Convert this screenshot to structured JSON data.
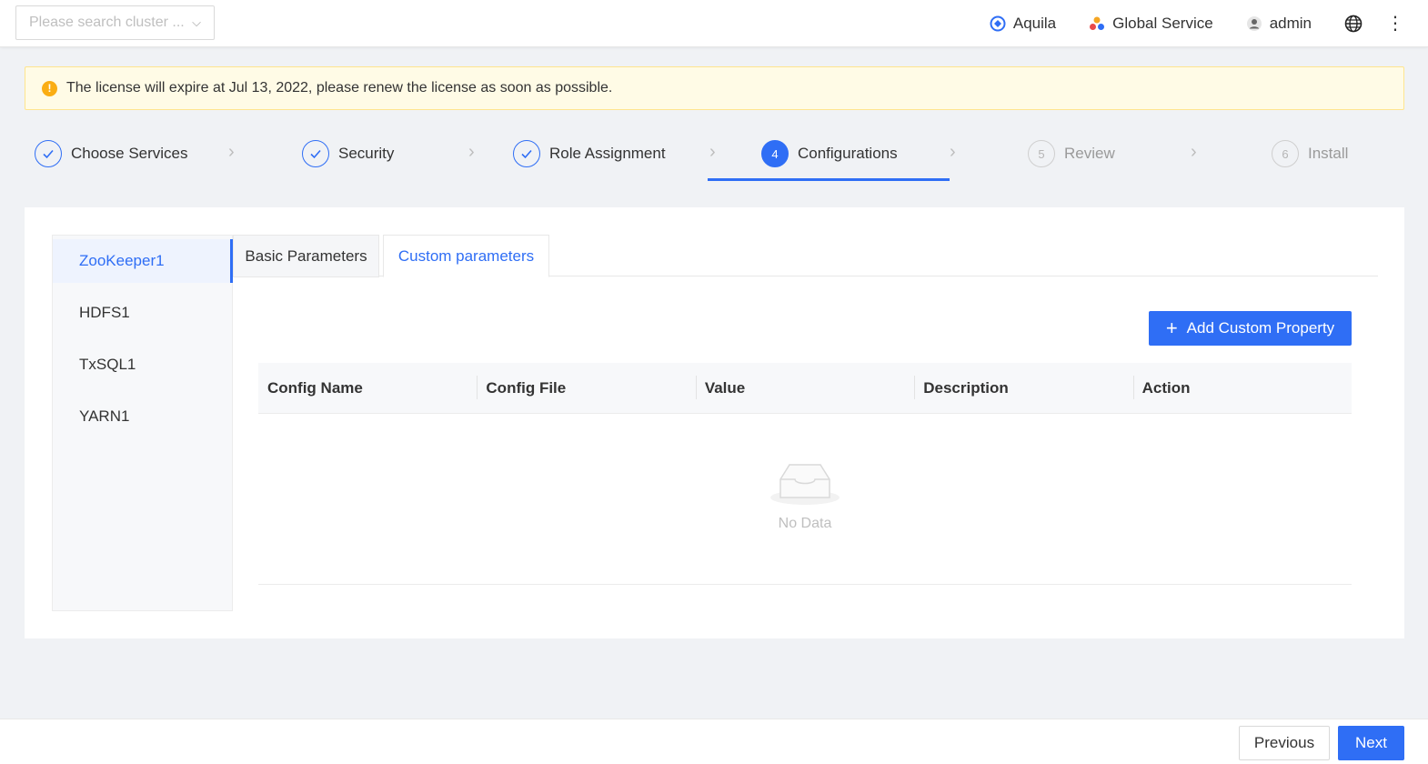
{
  "header": {
    "cluster_search": {
      "placeholder": "Please search cluster ..."
    },
    "product": "Aquila",
    "service": "Global Service",
    "user": "admin",
    "icons": [
      "aquila-logo-icon",
      "global-service-icon",
      "user-icon",
      "globe-icon",
      "more-vertical-icon"
    ]
  },
  "banner": {
    "message": "The license will expire at Jul 13, 2022, please renew the license as soon as possible.",
    "icon": "warning-icon",
    "color": "#faad14"
  },
  "steps": [
    {
      "label": "Choose Services",
      "status": "done"
    },
    {
      "label": "Security",
      "status": "done"
    },
    {
      "label": "Role Assignment",
      "status": "done"
    },
    {
      "label": "Configurations",
      "status": "active",
      "number": "4"
    },
    {
      "label": "Review",
      "status": "wait",
      "number": "5"
    },
    {
      "label": "Install",
      "status": "wait",
      "number": "6"
    }
  ],
  "services": [
    {
      "label": "ZooKeeper1",
      "active": true
    },
    {
      "label": "HDFS1"
    },
    {
      "label": "TxSQL1"
    },
    {
      "label": "YARN1"
    }
  ],
  "tabs": [
    {
      "label": "Basic Parameters"
    },
    {
      "label": "Custom parameters",
      "active": true
    }
  ],
  "add_button": "Add Custom Property",
  "table": {
    "columns": [
      "Config Name",
      "Config File",
      "Value",
      "Description",
      "Action"
    ],
    "rows": [],
    "empty_text": "No Data"
  },
  "footer": {
    "previous": "Previous",
    "next": "Next"
  },
  "colors": {
    "accent": "#2f6ef5",
    "warning": "#faad14"
  }
}
